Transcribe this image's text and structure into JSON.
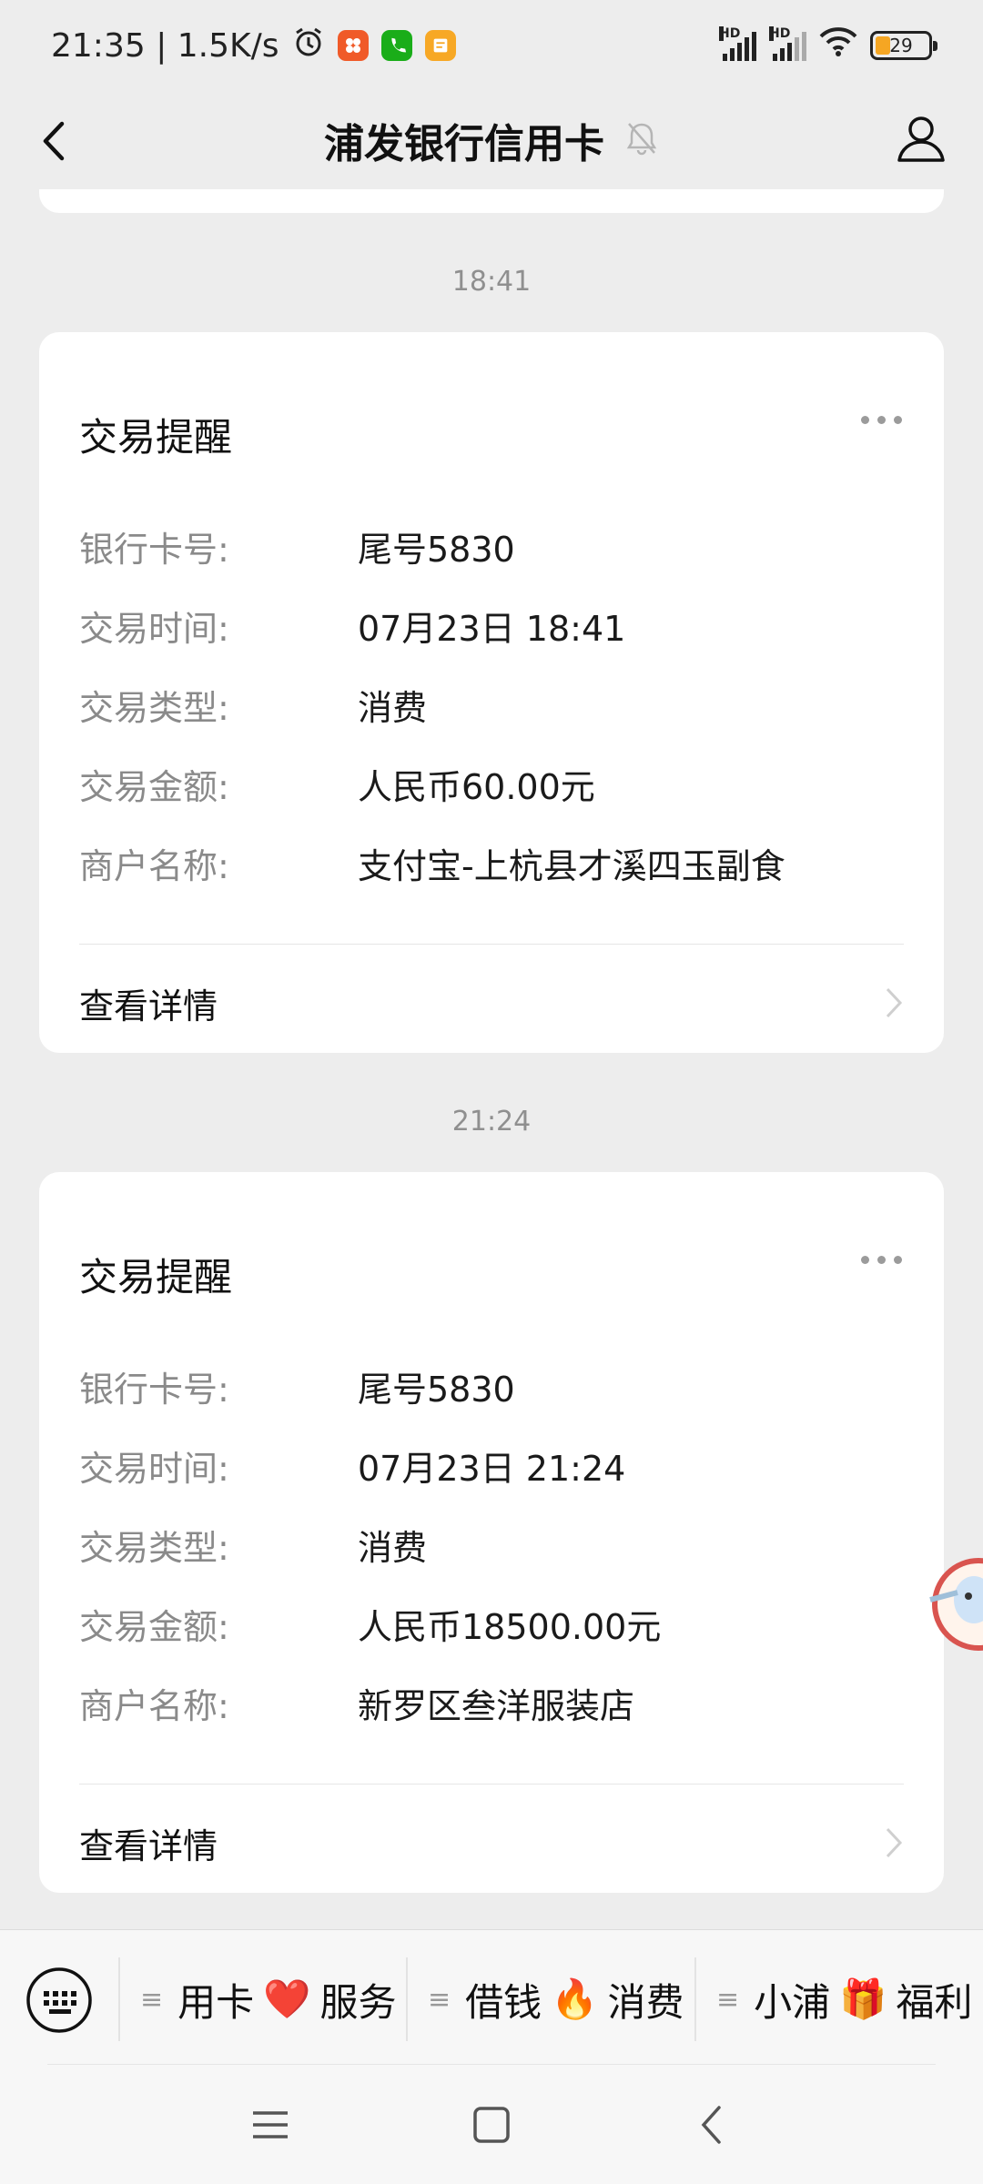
{
  "status_bar": {
    "time_speed": "21:35 | 1.5K/s",
    "hd1": "HD",
    "hd2": "HD",
    "battery": "29",
    "battery_level": 0.29,
    "icons": [
      "alarm-icon",
      "app-icon-orange",
      "phone-app-icon",
      "notes-app-icon",
      "signal-icon",
      "signal-icon",
      "wifi-icon",
      "battery-icon"
    ]
  },
  "header": {
    "title": "浦发银行信用卡",
    "icons": [
      "back-icon",
      "mute-bell-icon",
      "profile-icon"
    ]
  },
  "messages": [
    {
      "time": "18:41",
      "card_title": "交易提醒",
      "rows": [
        {
          "label": "银行卡号:",
          "value": "尾号5830"
        },
        {
          "label": "交易时间:",
          "value": "07月23日 18:41"
        },
        {
          "label": "交易类型:",
          "value": "消费"
        },
        {
          "label": "交易金额:",
          "value": "人民币60.00元"
        },
        {
          "label": "商户名称:",
          "value": "支付宝-上杭县才溪四玉副食"
        }
      ],
      "detail_link": "查看详情"
    },
    {
      "time": "21:24",
      "card_title": "交易提醒",
      "rows": [
        {
          "label": "银行卡号:",
          "value": "尾号5830"
        },
        {
          "label": "交易时间:",
          "value": "07月23日 21:24"
        },
        {
          "label": "交易类型:",
          "value": "消费"
        },
        {
          "label": "交易金额:",
          "value": "人民币18500.00元"
        },
        {
          "label": "商户名称:",
          "value": "新罗区叁洋服装店"
        }
      ],
      "detail_link": "查看详情"
    }
  ],
  "menu": {
    "items": [
      {
        "pre": "用卡",
        "emoji": "❤️",
        "post": "服务"
      },
      {
        "pre": "借钱",
        "emoji": "🔥",
        "post": "消费"
      },
      {
        "pre": "小浦",
        "emoji": "🎁",
        "post": "福利"
      }
    ]
  },
  "colors": {
    "background": "#ededed",
    "card": "#ffffff",
    "label": "#8a8a8a",
    "battery": "#f5a623"
  }
}
